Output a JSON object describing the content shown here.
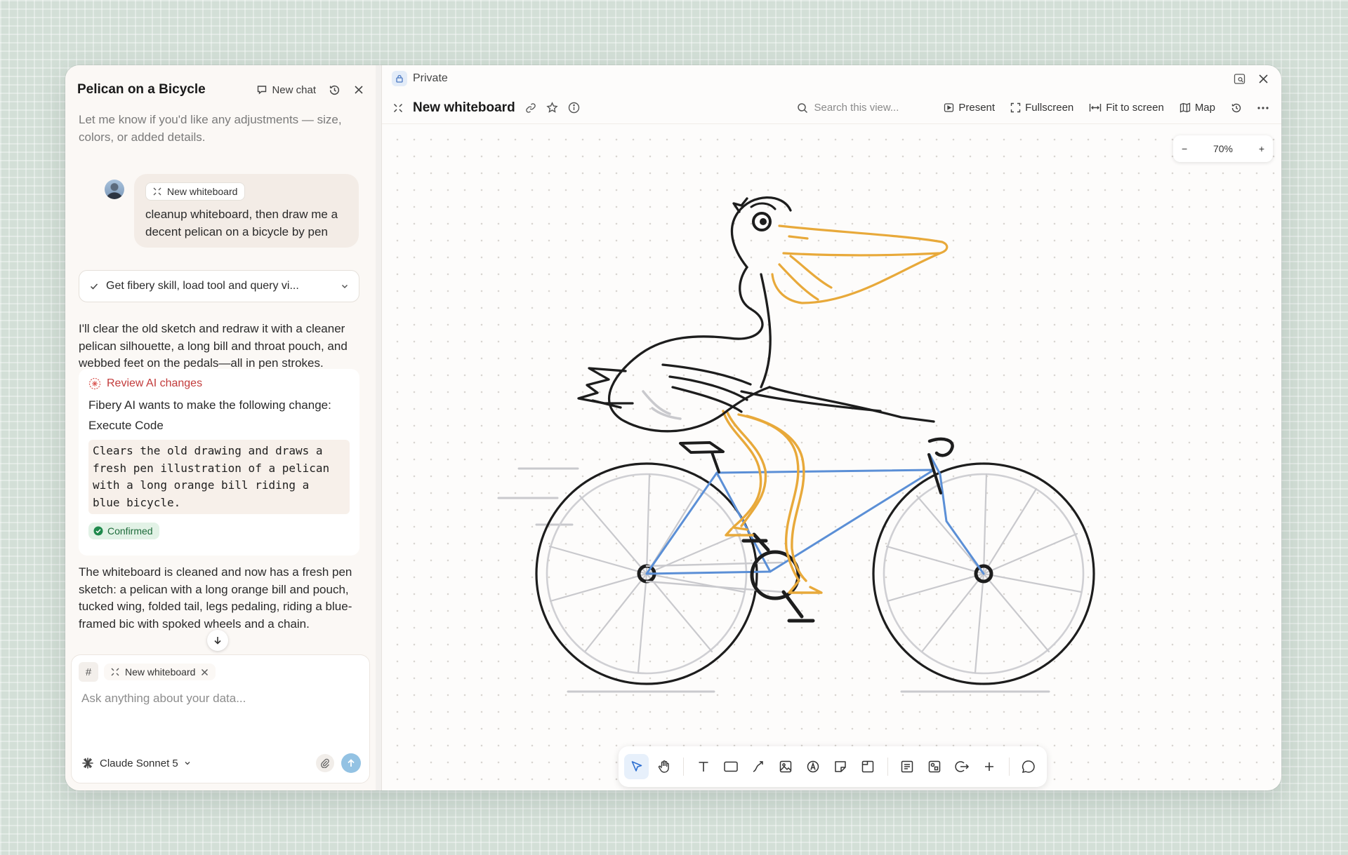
{
  "chat": {
    "title": "Pelican on a Bicycle",
    "new_chat_label": "New chat",
    "intro_text": "Let me know if you'd like any adjustments — size, colors, or added details.",
    "user_message": {
      "chip": "New whiteboard",
      "text": "cleanup whiteboard, then draw me a decent pelican on a bicycle by pen"
    },
    "tool_step": "Get fibery skill, load tool and query vi...",
    "assistant_text_1": "I'll clear the old sketch and redraw it with a cleaner pelican silhouette, a long bill and throat pouch, and webbed feet on the pedals—all in pen strokes.",
    "review": {
      "title": "Review AI changes",
      "line": "Fibery AI wants to make the following change:",
      "action": "Execute Code",
      "code": "Clears the old drawing and draws a\nfresh pen illustration of a pelican\nwith a long orange bill riding a\nblue bicycle.",
      "status": "Confirmed"
    },
    "assistant_text_2": "The whiteboard is cleaned and now has a fresh pen sketch: a pelican with a long orange bill and pouch, tucked wing, folded tail, legs pedaling, riding a blue-framed bic    with spoked wheels and a chain.",
    "composer": {
      "hash": "#",
      "chip": "New whiteboard",
      "placeholder": "Ask anything about your data...",
      "model": "Claude Sonnet 5"
    }
  },
  "board": {
    "visibility": "Private",
    "title": "New whiteboard",
    "search_placeholder": "Search this view...",
    "actions": {
      "present": "Present",
      "fullscreen": "Fullscreen",
      "fit": "Fit to screen",
      "map": "Map"
    },
    "zoom": "70%",
    "zoom_minus": "−",
    "zoom_plus": "+"
  },
  "colors": {
    "accent_blue": "#5b8fd6",
    "pelican_orange": "#e8a93a",
    "review_red": "#c23b3b",
    "confirmed_green": "#1d6b3a"
  }
}
